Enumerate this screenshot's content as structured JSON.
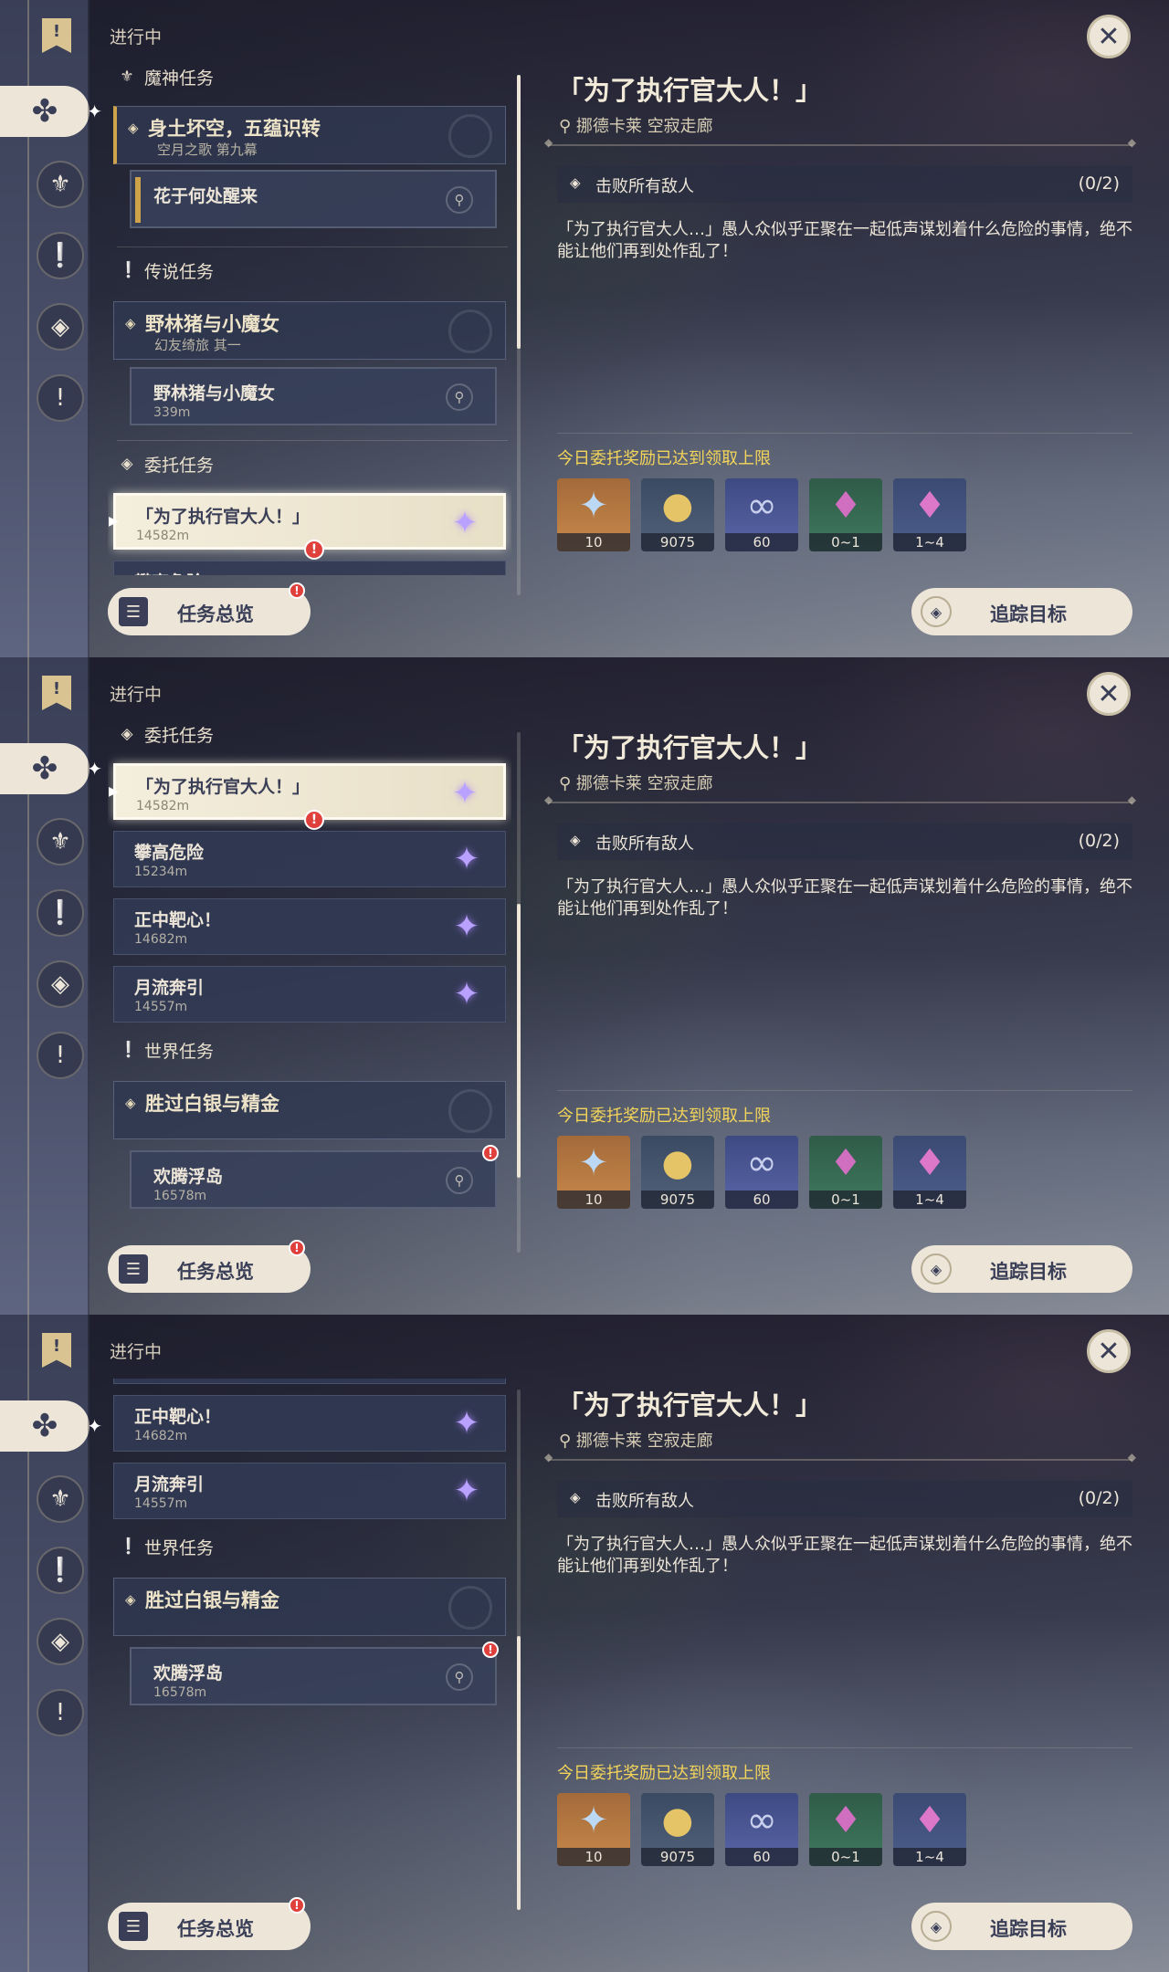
{
  "status_label": "进行中",
  "categories": {
    "archon": "魔神任务",
    "legend": "传说任务",
    "commission": "委托任务",
    "world": "世界任务"
  },
  "archon_quest": {
    "title": "身土坏空，五蕴识转",
    "subtitle": "空月之歌 第九幕"
  },
  "archon_step": {
    "title": "花于何处醒来"
  },
  "legend_quest": {
    "title": "野林猪与小魔女",
    "subtitle": "幻友绮旅 其一"
  },
  "legend_step": {
    "title": "野林猪与小魔女",
    "distance": "339m"
  },
  "commissions": [
    {
      "title": "「为了执行官大人！」",
      "distance": "14582m"
    },
    {
      "title": "攀高危险",
      "distance": "15234m"
    },
    {
      "title": "正中靶心！",
      "distance": "14682m"
    },
    {
      "title": "月流奔引",
      "distance": "14557m"
    }
  ],
  "world_quest": {
    "title": "胜过白银与精金"
  },
  "world_step": {
    "title": "欢腾浮岛",
    "distance": "16578m"
  },
  "badge": "!",
  "detail": {
    "title": "「为了执行官大人！」",
    "location": "挪德卡莱 空寂走廊",
    "objective": "击败所有敌人",
    "progress": "(0/2)",
    "description": "「为了执行官大人…」愚人众似乎正聚在一起低声谋划着什么危险的事情，绝不能让他们再到处作乱了！",
    "reward_note": "今日委托奖励已达到领取上限",
    "rewards": [
      {
        "icon": "primogem-icon",
        "count": "10"
      },
      {
        "icon": "mora-icon",
        "count": "9075"
      },
      {
        "icon": "companionship-exp-icon",
        "count": "60"
      },
      {
        "icon": "crystal-green-icon",
        "count": "0~1"
      },
      {
        "icon": "crystal-purple-icon",
        "count": "1~4"
      }
    ]
  },
  "buttons": {
    "overview": "任务总览",
    "track": "追踪目标"
  },
  "colors": {
    "accent_gold": "#cfa34a",
    "reward_note": "#f4d55a",
    "badge_red": "#e0403c",
    "commission_star": "#b9a2ff"
  }
}
